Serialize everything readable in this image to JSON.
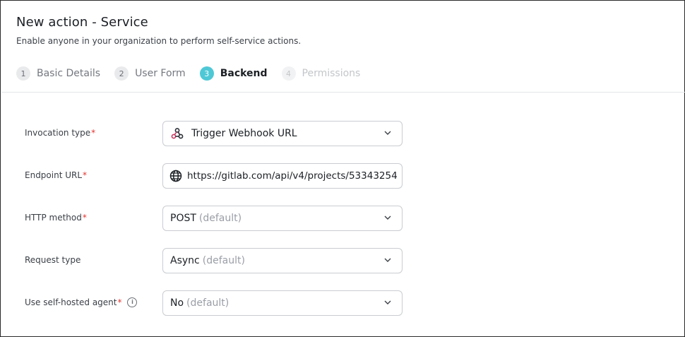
{
  "header": {
    "title": "New action - Service",
    "subtitle": "Enable anyone in your organization to perform self-service actions."
  },
  "steps": [
    {
      "num": "1",
      "label": "Basic Details",
      "state": "done"
    },
    {
      "num": "2",
      "label": "User Form",
      "state": "done"
    },
    {
      "num": "3",
      "label": "Backend",
      "state": "active"
    },
    {
      "num": "4",
      "label": "Permissions",
      "state": "disabled"
    }
  ],
  "form": {
    "invocation_type": {
      "label": "Invocation type",
      "required_mark": "*",
      "value": "Trigger Webhook URL",
      "icon": "webhook-icon"
    },
    "endpoint_url": {
      "label": "Endpoint URL",
      "required_mark": "*",
      "value": "https://gitlab.com/api/v4/projects/53343254",
      "icon": "globe-icon"
    },
    "http_method": {
      "label": "HTTP method",
      "required_mark": "*",
      "value": "POST",
      "suffix": "(default)"
    },
    "request_type": {
      "label": "Request type",
      "value": "Async",
      "suffix": "(default)"
    },
    "self_hosted_agent": {
      "label": "Use self-hosted agent",
      "required_mark": "*",
      "value": "No",
      "suffix": "(default)",
      "info_icon": "info-icon"
    }
  },
  "colors": {
    "accent": "#4fc8d6",
    "required": "#e3342f",
    "webhook_icon": "#c73a63"
  }
}
